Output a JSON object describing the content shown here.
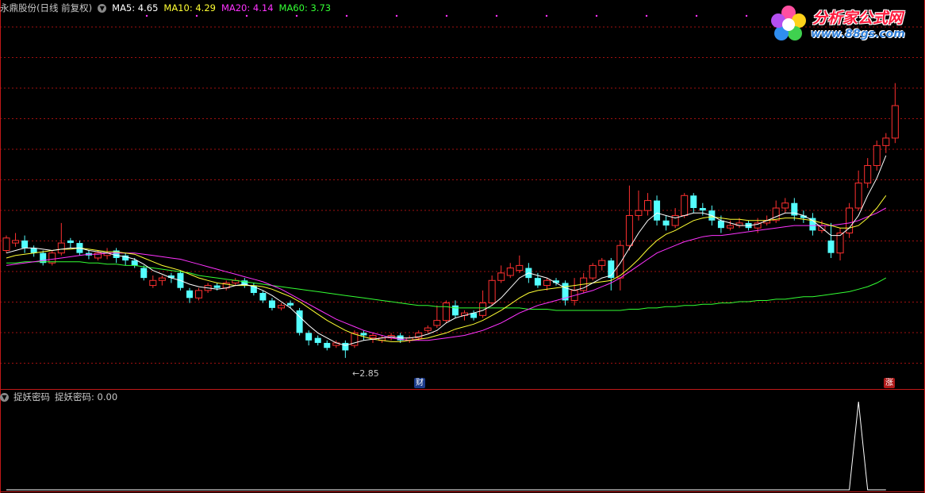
{
  "header": {
    "title": "永鼎股份(日线 前复权)",
    "ma5": "MA5: 4.65",
    "ma10": "MA10: 4.29",
    "ma20": "MA20: 4.14",
    "ma60": "MA60: 3.73"
  },
  "indicator": {
    "name": "捉妖密码",
    "value_label": "捉妖密码: 0.00"
  },
  "logo": {
    "text": "分析家公式网",
    "url": "www.88gs.com"
  },
  "markers": {
    "low_label": "←2.85",
    "cai": "财",
    "zhang": "涨"
  },
  "colors": {
    "up": "#ff3030",
    "down": "#54ffff",
    "ma5": "#ffffff",
    "ma10": "#ffff33",
    "ma20": "#ff33ff",
    "ma60": "#33ff33",
    "grid": "#a01010",
    "indicator": "#ffffff"
  },
  "chart_data": [
    {
      "type": "candlestick",
      "title": "永鼎股份(日线 前复权)",
      "ylim": [
        2.6,
        5.6
      ],
      "grid": true,
      "low_annotation": 2.85,
      "candles": [
        [
          3.62,
          3.72,
          3.6,
          3.74
        ],
        [
          3.68,
          3.7,
          3.65,
          3.76
        ],
        [
          3.7,
          3.64,
          3.6,
          3.74
        ],
        [
          3.64,
          3.6,
          3.57,
          3.66
        ],
        [
          3.6,
          3.52,
          3.5,
          3.62
        ],
        [
          3.52,
          3.6,
          3.5,
          3.62
        ],
        [
          3.6,
          3.68,
          3.58,
          3.84
        ],
        [
          3.7,
          3.68,
          3.64,
          3.72
        ],
        [
          3.68,
          3.6,
          3.58,
          3.7
        ],
        [
          3.6,
          3.58,
          3.55,
          3.62
        ],
        [
          3.56,
          3.6,
          3.54,
          3.62
        ],
        [
          3.58,
          3.6,
          3.55,
          3.64
        ],
        [
          3.62,
          3.56,
          3.52,
          3.64
        ],
        [
          3.58,
          3.54,
          3.5,
          3.6
        ],
        [
          3.54,
          3.5,
          3.48,
          3.56
        ],
        [
          3.48,
          3.4,
          3.38,
          3.5
        ],
        [
          3.34,
          3.38,
          3.32,
          3.42
        ],
        [
          3.38,
          3.4,
          3.34,
          3.42
        ],
        [
          3.42,
          3.4,
          3.36,
          3.44
        ],
        [
          3.44,
          3.32,
          3.3,
          3.46
        ],
        [
          3.3,
          3.24,
          3.2,
          3.32
        ],
        [
          3.24,
          3.3,
          3.22,
          3.32
        ],
        [
          3.3,
          3.34,
          3.28,
          3.36
        ],
        [
          3.34,
          3.32,
          3.3,
          3.36
        ],
        [
          3.32,
          3.36,
          3.3,
          3.38
        ],
        [
          3.36,
          3.38,
          3.34,
          3.4
        ],
        [
          3.38,
          3.34,
          3.32,
          3.4
        ],
        [
          3.34,
          3.28,
          3.26,
          3.36
        ],
        [
          3.28,
          3.22,
          3.2,
          3.3
        ],
        [
          3.22,
          3.16,
          3.14,
          3.24
        ],
        [
          3.16,
          3.18,
          3.14,
          3.2
        ],
        [
          3.2,
          3.18,
          3.16,
          3.22
        ],
        [
          3.14,
          2.96,
          2.94,
          3.16
        ],
        [
          2.96,
          2.9,
          2.86,
          2.98
        ],
        [
          2.92,
          2.88,
          2.86,
          2.94
        ],
        [
          2.88,
          2.84,
          2.82,
          2.9
        ],
        [
          2.86,
          2.88,
          2.84,
          2.9
        ],
        [
          2.88,
          2.82,
          2.76,
          2.9
        ],
        [
          2.86,
          2.96,
          2.84,
          2.98
        ],
        [
          2.96,
          2.94,
          2.9,
          2.98
        ],
        [
          2.92,
          2.94,
          2.88,
          2.96
        ],
        [
          2.9,
          2.92,
          2.88,
          2.94
        ],
        [
          2.92,
          2.94,
          2.9,
          2.96
        ],
        [
          2.94,
          2.9,
          2.88,
          2.96
        ],
        [
          2.9,
          2.92,
          2.88,
          2.94
        ],
        [
          2.92,
          2.96,
          2.9,
          2.98
        ],
        [
          2.98,
          3.0,
          2.96,
          3.02
        ],
        [
          3.02,
          3.06,
          3.0,
          3.18
        ],
        [
          3.06,
          3.2,
          3.04,
          3.22
        ],
        [
          3.18,
          3.1,
          3.08,
          3.22
        ],
        [
          3.1,
          3.12,
          3.06,
          3.14
        ],
        [
          3.12,
          3.08,
          3.06,
          3.14
        ],
        [
          3.1,
          3.2,
          3.08,
          3.3
        ],
        [
          3.2,
          3.38,
          3.18,
          3.42
        ],
        [
          3.38,
          3.44,
          3.36,
          3.5
        ],
        [
          3.42,
          3.48,
          3.4,
          3.52
        ],
        [
          3.46,
          3.5,
          3.44,
          3.58
        ],
        [
          3.48,
          3.4,
          3.36,
          3.52
        ],
        [
          3.4,
          3.34,
          3.32,
          3.44
        ],
        [
          3.34,
          3.38,
          3.3,
          3.4
        ],
        [
          3.38,
          3.36,
          3.34,
          3.4
        ],
        [
          3.36,
          3.22,
          3.18,
          3.38
        ],
        [
          3.22,
          3.3,
          3.18,
          3.4
        ],
        [
          3.3,
          3.4,
          3.28,
          3.44
        ],
        [
          3.4,
          3.5,
          3.38,
          3.52
        ],
        [
          3.5,
          3.54,
          3.46,
          3.56
        ],
        [
          3.54,
          3.4,
          3.3,
          3.56
        ],
        [
          3.4,
          3.66,
          3.3,
          3.7
        ],
        [
          3.66,
          3.9,
          3.62,
          4.14
        ],
        [
          3.9,
          3.94,
          3.86,
          4.1
        ],
        [
          3.94,
          4.02,
          3.9,
          4.08
        ],
        [
          4.02,
          3.86,
          3.82,
          4.06
        ],
        [
          3.86,
          3.82,
          3.78,
          3.9
        ],
        [
          3.82,
          3.9,
          3.8,
          3.96
        ],
        [
          3.9,
          4.06,
          3.88,
          4.08
        ],
        [
          4.06,
          3.96,
          3.92,
          4.08
        ],
        [
          3.96,
          3.94,
          3.9,
          4.0
        ],
        [
          3.94,
          3.86,
          3.82,
          3.98
        ],
        [
          3.86,
          3.8,
          3.76,
          3.9
        ],
        [
          3.8,
          3.82,
          3.78,
          3.86
        ],
        [
          3.82,
          3.84,
          3.8,
          3.88
        ],
        [
          3.84,
          3.8,
          3.78,
          3.86
        ],
        [
          3.8,
          3.84,
          3.76,
          3.88
        ],
        [
          3.84,
          3.86,
          3.82,
          3.9
        ],
        [
          3.86,
          3.96,
          3.84,
          4.02
        ],
        [
          3.96,
          4.0,
          3.92,
          4.04
        ],
        [
          4.0,
          3.9,
          3.86,
          4.04
        ],
        [
          3.9,
          3.88,
          3.84,
          3.94
        ],
        [
          3.88,
          3.78,
          3.74,
          3.92
        ],
        [
          3.78,
          3.82,
          3.76,
          3.86
        ],
        [
          3.7,
          3.6,
          3.56,
          3.84
        ],
        [
          3.6,
          3.76,
          3.54,
          3.8
        ],
        [
          3.76,
          3.96,
          3.72,
          4.0
        ],
        [
          3.96,
          4.16,
          3.94,
          4.26
        ],
        [
          4.16,
          4.3,
          4.12,
          4.36
        ],
        [
          4.3,
          4.46,
          4.26,
          4.5
        ],
        [
          4.46,
          4.52,
          4.4,
          4.56
        ],
        [
          4.52,
          4.78,
          4.48,
          4.96
        ]
      ],
      "ma5": [
        3.6,
        3.62,
        3.64,
        3.64,
        3.63,
        3.62,
        3.63,
        3.64,
        3.64,
        3.62,
        3.61,
        3.6,
        3.58,
        3.57,
        3.55,
        3.51,
        3.46,
        3.43,
        3.4,
        3.38,
        3.35,
        3.33,
        3.32,
        3.31,
        3.32,
        3.34,
        3.35,
        3.33,
        3.3,
        3.26,
        3.21,
        3.16,
        3.09,
        3.02,
        2.96,
        2.92,
        2.88,
        2.86,
        2.88,
        2.9,
        2.91,
        2.92,
        2.93,
        2.92,
        2.92,
        2.93,
        2.95,
        2.98,
        3.04,
        3.08,
        3.1,
        3.12,
        3.14,
        3.18,
        3.24,
        3.32,
        3.4,
        3.44,
        3.42,
        3.4,
        3.36,
        3.32,
        3.3,
        3.32,
        3.36,
        3.4,
        3.42,
        3.52,
        3.64,
        3.76,
        3.86,
        3.92,
        3.9,
        3.88,
        3.9,
        3.92,
        3.92,
        3.9,
        3.86,
        3.84,
        3.82,
        3.82,
        3.83,
        3.86,
        3.89,
        3.92,
        3.92,
        3.9,
        3.86,
        3.8,
        3.74,
        3.74,
        3.8,
        3.9,
        4.06,
        4.2,
        4.38
      ],
      "ma10": [
        3.56,
        3.58,
        3.59,
        3.6,
        3.61,
        3.62,
        3.63,
        3.63,
        3.64,
        3.63,
        3.62,
        3.61,
        3.61,
        3.6,
        3.59,
        3.56,
        3.53,
        3.5,
        3.48,
        3.46,
        3.43,
        3.4,
        3.38,
        3.36,
        3.35,
        3.34,
        3.34,
        3.34,
        3.33,
        3.31,
        3.28,
        3.25,
        3.21,
        3.16,
        3.11,
        3.06,
        3.02,
        2.98,
        2.95,
        2.93,
        2.91,
        2.9,
        2.89,
        2.89,
        2.9,
        2.91,
        2.92,
        2.94,
        2.96,
        2.99,
        3.01,
        3.03,
        3.06,
        3.1,
        3.14,
        3.19,
        3.24,
        3.28,
        3.3,
        3.31,
        3.32,
        3.33,
        3.34,
        3.35,
        3.36,
        3.37,
        3.38,
        3.42,
        3.48,
        3.55,
        3.63,
        3.7,
        3.75,
        3.78,
        3.82,
        3.86,
        3.88,
        3.89,
        3.88,
        3.87,
        3.87,
        3.86,
        3.86,
        3.86,
        3.87,
        3.88,
        3.88,
        3.87,
        3.86,
        3.84,
        3.82,
        3.8,
        3.8,
        3.82,
        3.88,
        3.96,
        4.06
      ],
      "ma20": [
        3.5,
        3.51,
        3.52,
        3.53,
        3.54,
        3.55,
        3.56,
        3.57,
        3.58,
        3.59,
        3.59,
        3.6,
        3.6,
        3.6,
        3.6,
        3.59,
        3.58,
        3.57,
        3.56,
        3.55,
        3.53,
        3.51,
        3.49,
        3.47,
        3.45,
        3.43,
        3.41,
        3.39,
        3.37,
        3.34,
        3.31,
        3.27,
        3.23,
        3.19,
        3.15,
        3.11,
        3.07,
        3.04,
        3.01,
        2.98,
        2.96,
        2.94,
        2.92,
        2.91,
        2.9,
        2.9,
        2.9,
        2.91,
        2.92,
        2.93,
        2.94,
        2.96,
        2.98,
        3.01,
        3.04,
        3.08,
        3.12,
        3.15,
        3.18,
        3.2,
        3.22,
        3.24,
        3.26,
        3.28,
        3.3,
        3.33,
        3.36,
        3.4,
        3.45,
        3.5,
        3.55,
        3.6,
        3.63,
        3.66,
        3.69,
        3.71,
        3.73,
        3.74,
        3.74,
        3.75,
        3.76,
        3.77,
        3.78,
        3.79,
        3.8,
        3.81,
        3.82,
        3.82,
        3.82,
        3.82,
        3.82,
        3.83,
        3.84,
        3.86,
        3.89,
        3.92,
        3.96
      ],
      "ma60": [
        3.52,
        3.52,
        3.53,
        3.53,
        3.53,
        3.53,
        3.53,
        3.53,
        3.53,
        3.52,
        3.52,
        3.51,
        3.51,
        3.5,
        3.5,
        3.49,
        3.48,
        3.47,
        3.46,
        3.45,
        3.44,
        3.42,
        3.41,
        3.4,
        3.39,
        3.38,
        3.37,
        3.36,
        3.35,
        3.34,
        3.33,
        3.32,
        3.31,
        3.3,
        3.29,
        3.28,
        3.27,
        3.26,
        3.25,
        3.24,
        3.23,
        3.22,
        3.21,
        3.2,
        3.19,
        3.18,
        3.18,
        3.17,
        3.17,
        3.16,
        3.16,
        3.16,
        3.16,
        3.16,
        3.16,
        3.16,
        3.16,
        3.15,
        3.15,
        3.15,
        3.14,
        3.14,
        3.14,
        3.14,
        3.14,
        3.14,
        3.14,
        3.14,
        3.15,
        3.15,
        3.16,
        3.16,
        3.17,
        3.17,
        3.18,
        3.18,
        3.19,
        3.19,
        3.2,
        3.2,
        3.21,
        3.21,
        3.22,
        3.22,
        3.23,
        3.23,
        3.24,
        3.25,
        3.25,
        3.26,
        3.27,
        3.28,
        3.29,
        3.31,
        3.33,
        3.36,
        3.4
      ]
    },
    {
      "type": "line",
      "title": "捉妖密码",
      "ylim": [
        0,
        1
      ],
      "values_by_candle_index": {
        "length": 97,
        "spike_index": 93,
        "spike_value": 1,
        "other_value": 0
      }
    }
  ]
}
